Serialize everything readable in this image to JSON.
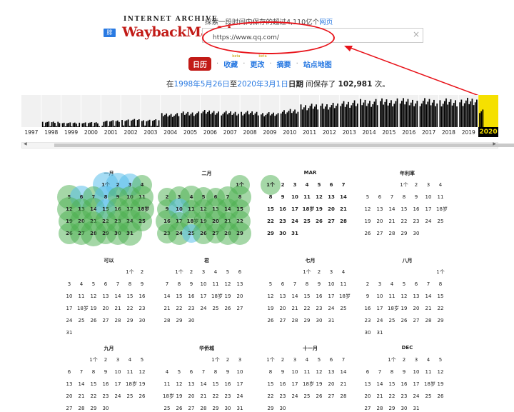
{
  "header": {
    "lang_badge": "腓",
    "logo_top": "INTERNET ARCHIVE",
    "logo_main": "WaybackMachine",
    "explore_text": "探索一段时间内保存的超过4,110亿个",
    "explore_link": "网页",
    "url_value": "https://www.qq.com/",
    "clear_symbol": "×"
  },
  "nav": {
    "tabs": [
      {
        "label": "日历",
        "active": true
      },
      {
        "label": "收藏",
        "beta": "beta"
      },
      {
        "label": "更改",
        "beta": "beta"
      },
      {
        "label": "摘要"
      },
      {
        "label": "站点地图"
      }
    ],
    "separator": "·"
  },
  "saved": {
    "prefix": "在",
    "from": "1998年5月26日",
    "to_word": "至",
    "to": "2020年3月1日",
    "date_word": "日期",
    "mid": " 间保存了 ",
    "count": "102,981",
    "suffix": " 次。"
  },
  "timeline": {
    "years": [
      "1997",
      "1998",
      "1999",
      "2000",
      "2001",
      "2002",
      "2003",
      "2004",
      "2005",
      "2006",
      "2007",
      "2008",
      "2009",
      "2010",
      "2011",
      "2012",
      "2013",
      "2014",
      "2015",
      "2016",
      "2017",
      "2018",
      "2019",
      "2020"
    ],
    "current_year": "2020",
    "relative_activity": [
      0.0,
      0.18,
      0.15,
      0.16,
      0.22,
      0.26,
      0.25,
      0.45,
      0.5,
      0.55,
      0.52,
      0.52,
      0.48,
      0.58,
      0.75,
      0.78,
      0.86,
      0.9,
      0.92,
      0.93,
      0.93,
      0.92,
      0.94,
      0.6
    ],
    "bar_color": "#000000",
    "highlight_color": "#f5e000"
  },
  "calendar": {
    "months": [
      {
        "name": "一月",
        "lead": 3,
        "days": 31,
        "bold": true
      },
      {
        "name": "二月",
        "lead": 6,
        "days": 29,
        "bold": true
      },
      {
        "name": "MAR",
        "lead": 0,
        "days": 31,
        "bold": true
      },
      {
        "name": "年利率",
        "lead": 3,
        "days": 30,
        "bold": false
      },
      {
        "name": "可以",
        "lead": 5,
        "days": 31,
        "bold": false
      },
      {
        "name": "君",
        "lead": 1,
        "days": 30,
        "bold": false
      },
      {
        "name": "七月",
        "lead": 3,
        "days": 31,
        "bold": false
      },
      {
        "name": "八月",
        "lead": 6,
        "days": 31,
        "bold": false
      },
      {
        "name": "九月",
        "lead": 2,
        "days": 30,
        "bold": false
      },
      {
        "name": "华侨城",
        "lead": 4,
        "days": 31,
        "bold": false
      },
      {
        "name": "十一月",
        "lead": 0,
        "days": 30,
        "bold": false
      },
      {
        "name": "DEC",
        "lead": 2,
        "days": 31,
        "bold": false
      }
    ],
    "day_one_label": "1个",
    "day_18_label": "18岁",
    "green": "#4caf50",
    "blue": "#5bc0eb"
  }
}
